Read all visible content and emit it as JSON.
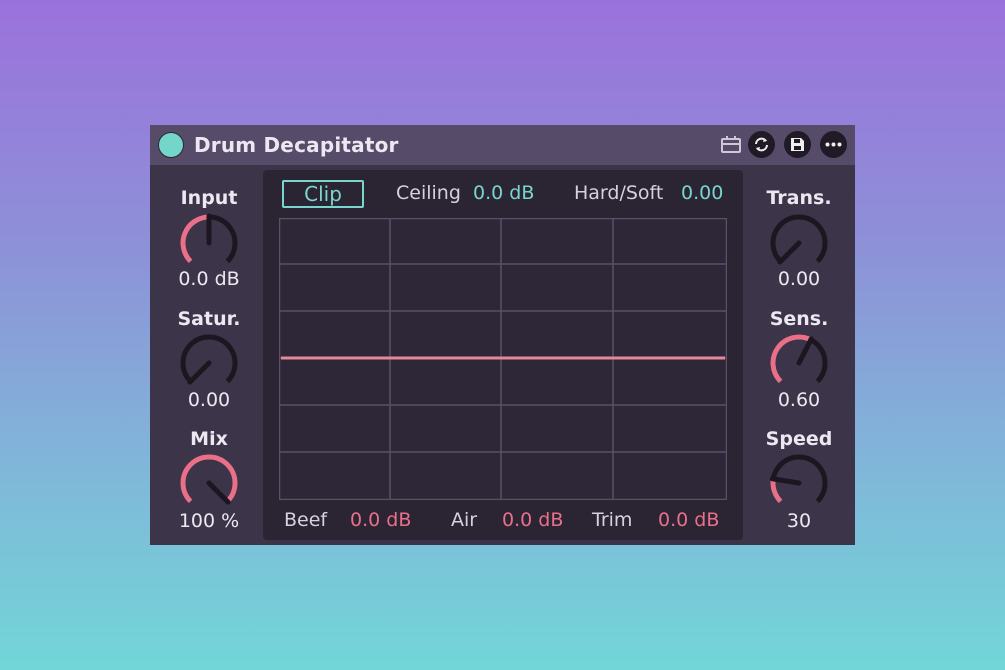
{
  "device": {
    "title": "Drum Decapitator",
    "accent_teal": "#79d6cf",
    "accent_pink": "#ea708a",
    "icons": [
      "power-icon",
      "preset-icon",
      "sync-icon",
      "save-icon",
      "more-icon"
    ]
  },
  "left_knobs": [
    {
      "label": "Input",
      "value": "0.0 dB",
      "level": 0.5
    },
    {
      "label": "Satur.",
      "value": "0.00",
      "level": 0.0
    },
    {
      "label": "Mix",
      "value": "100 %",
      "level": 1.0
    }
  ],
  "right_knobs": [
    {
      "label": "Trans.",
      "value": "0.00",
      "level": 0.0
    },
    {
      "label": "Sens.",
      "value": "0.60",
      "level": 0.6
    },
    {
      "label": "Speed",
      "value": "30",
      "level": 0.2
    }
  ],
  "display": {
    "clip_label": "Clip",
    "ceiling_label": "Ceiling",
    "ceiling_value": "0.0 dB",
    "hardsoft_label": "Hard/Soft",
    "hardsoft_value": "0.00",
    "beef_label": "Beef",
    "beef_value": "0.0 dB",
    "air_label": "Air",
    "air_value": "0.0 dB",
    "trim_label": "Trim",
    "trim_value": "0.0 dB"
  }
}
